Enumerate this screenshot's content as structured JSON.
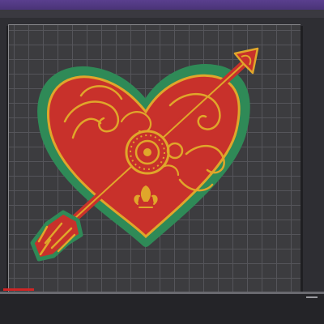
{
  "app": {
    "accent": "#4a3478"
  },
  "scene": {
    "bed_color": "#3c3c3f",
    "grid_color": "#55555a",
    "model": {
      "name_icon": "heart-with-arrow-model",
      "fill_color": "#c8312b",
      "accent_color": "#e0a62a",
      "outline_color": "#2f8a57"
    }
  }
}
